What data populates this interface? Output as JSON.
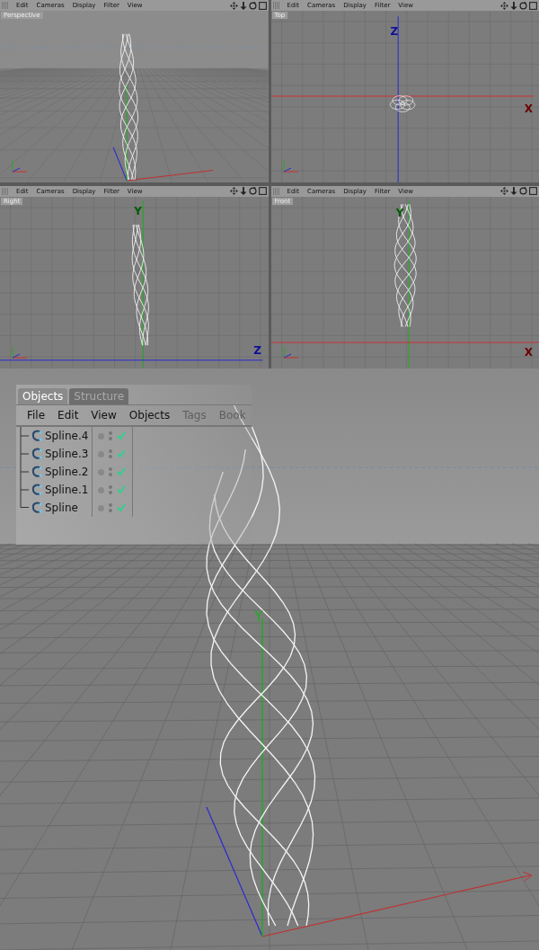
{
  "viewports": [
    {
      "kind": "perspective",
      "label": "Perspective",
      "menu": [
        "Edit",
        "Cameras",
        "Display",
        "Filter",
        "View"
      ]
    },
    {
      "kind": "top",
      "label": "Top",
      "menu": [
        "Edit",
        "Cameras",
        "Display",
        "Filter",
        "View"
      ],
      "axis_labels": [
        "Z",
        "X"
      ]
    },
    {
      "kind": "right",
      "label": "Right",
      "menu": [
        "Edit",
        "Cameras",
        "Display",
        "Filter",
        "View"
      ],
      "axis_labels": [
        "Y",
        "Z"
      ]
    },
    {
      "kind": "front",
      "label": "Front",
      "menu": [
        "Edit",
        "Cameras",
        "Display",
        "Filter",
        "View"
      ],
      "axis_labels": [
        "Y",
        "X"
      ]
    }
  ],
  "main_view": {
    "axis_labels": [
      "Y"
    ]
  },
  "object_manager": {
    "tabs": [
      {
        "label": "Objects",
        "selected": true
      },
      {
        "label": "Structure",
        "selected": false
      }
    ],
    "menu": [
      {
        "label": "File",
        "disabled": false
      },
      {
        "label": "Edit",
        "disabled": false
      },
      {
        "label": "View",
        "disabled": false
      },
      {
        "label": "Objects",
        "disabled": false
      },
      {
        "label": "Tags",
        "disabled": true
      },
      {
        "label": "Book",
        "disabled": true
      }
    ],
    "objects": [
      {
        "name": "Spline.4",
        "enabled": true
      },
      {
        "name": "Spline.3",
        "enabled": true
      },
      {
        "name": "Spline.2",
        "enabled": true
      },
      {
        "name": "Spline.1",
        "enabled": true
      },
      {
        "name": "Spline",
        "enabled": true
      }
    ]
  }
}
